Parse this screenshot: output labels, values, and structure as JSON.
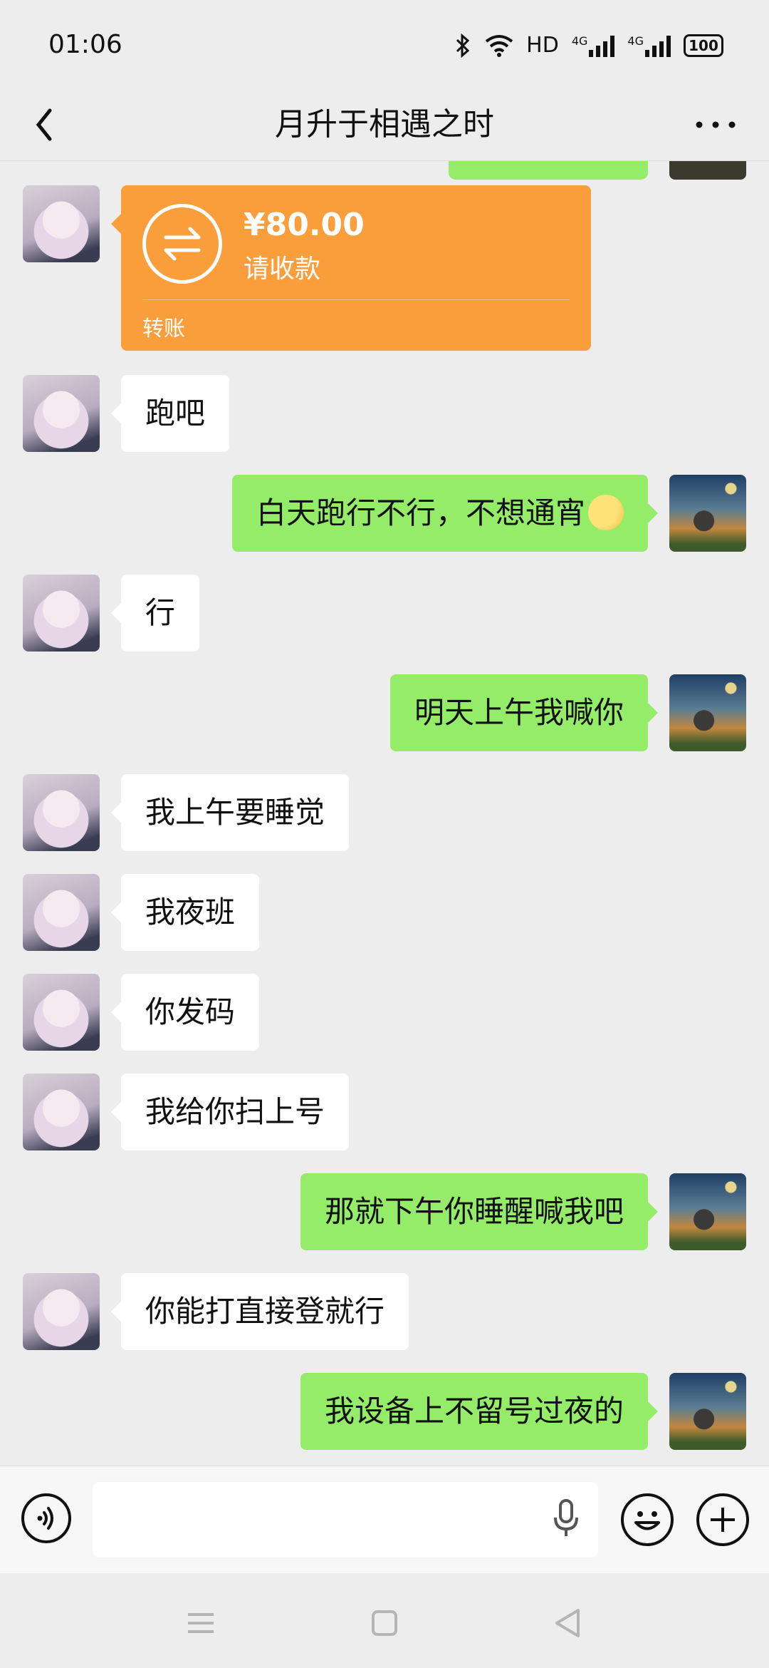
{
  "status_bar": {
    "time": "01:06",
    "network": "HD",
    "signal_1": "4G",
    "signal_2": "4G",
    "battery": "100"
  },
  "header": {
    "title": "月升于相遇之时"
  },
  "transfer": {
    "amount": "¥80.00",
    "status": "请收款",
    "label": "转账"
  },
  "messages": [
    {
      "side": "left",
      "text": "跑吧"
    },
    {
      "side": "right",
      "text": "白天跑行不行，不想通宵",
      "emoji": "rolling-laughing-emoji"
    },
    {
      "side": "left",
      "text": "行"
    },
    {
      "side": "right",
      "text": "明天上午我喊你"
    },
    {
      "side": "left",
      "text": "我上午要睡觉"
    },
    {
      "side": "left",
      "text": "我夜班"
    },
    {
      "side": "left",
      "text": "你发码"
    },
    {
      "side": "left",
      "text": "我给你扫上号"
    },
    {
      "side": "right",
      "text": "那就下午你睡醒喊我吧"
    },
    {
      "side": "left",
      "text": "你能打直接登就行"
    },
    {
      "side": "right",
      "text": "我设备上不留号过夜的"
    }
  ],
  "input": {
    "value": "",
    "placeholder": ""
  },
  "colors": {
    "background": "#ededed",
    "self_bubble": "#95ec69",
    "other_bubble": "#ffffff",
    "transfer_card": "#fa9d3b"
  }
}
